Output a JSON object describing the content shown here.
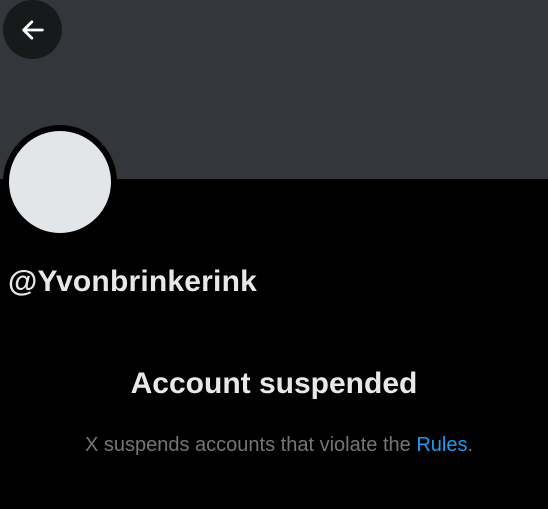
{
  "profile": {
    "handle": "@Yvonbrinkerink"
  },
  "suspension": {
    "title": "Account suspended",
    "message_prefix": "X suspends accounts that violate the ",
    "rules_link": "Rules",
    "message_suffix": "."
  },
  "icons": {
    "back": "arrow-left-icon"
  },
  "colors": {
    "banner": "#33363a",
    "background": "#000000",
    "avatar": "#e2e6e9",
    "link": "#1d9bf0",
    "secondary_text": "#72767b",
    "primary_text": "#e8e8e8"
  }
}
